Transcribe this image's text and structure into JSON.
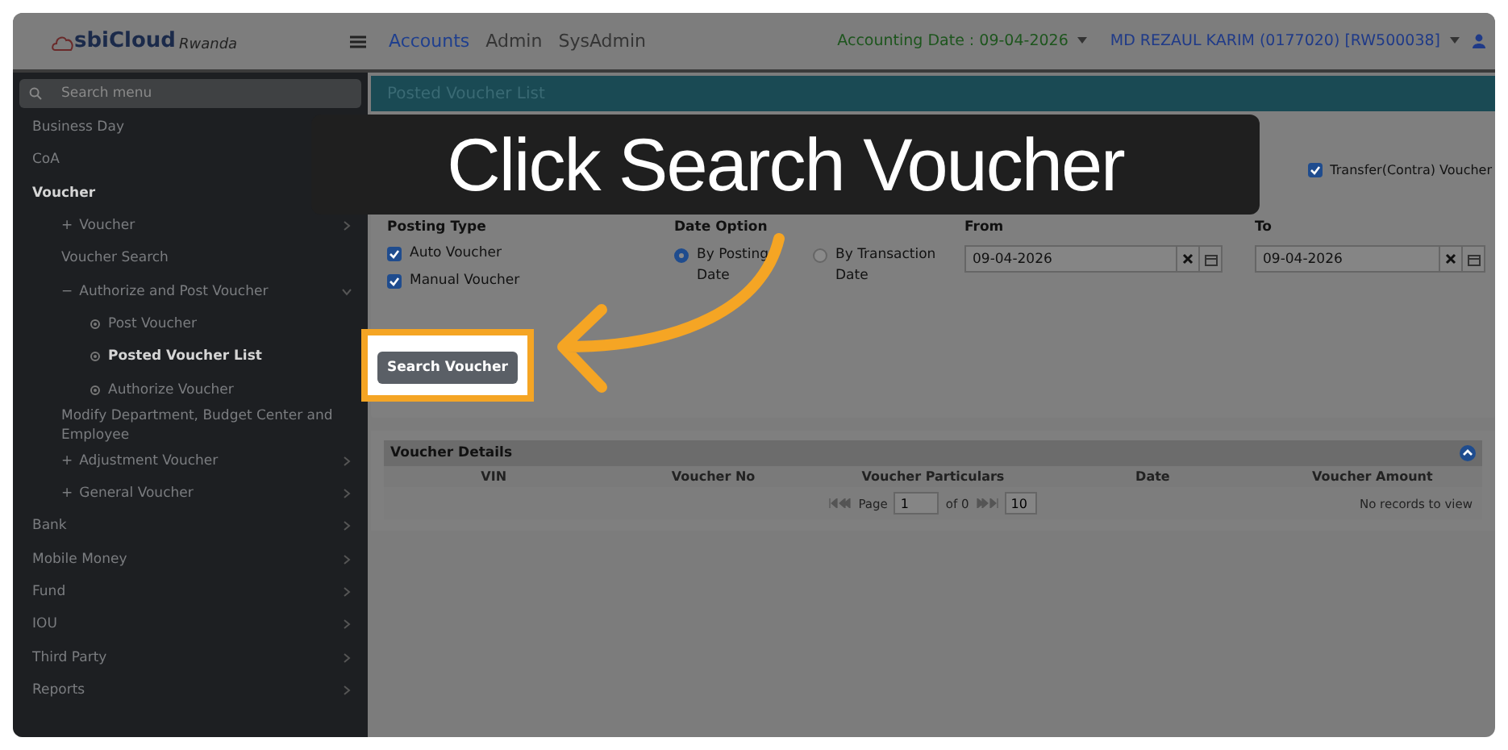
{
  "brand": {
    "name": "sbiCloud",
    "region": "Rwanda"
  },
  "nav": [
    {
      "label": "Accounts",
      "selected": true
    },
    {
      "label": "Admin",
      "selected": false
    },
    {
      "label": "SysAdmin",
      "selected": false
    }
  ],
  "accounting_date": "Accounting Date : 09-04-2026",
  "user": "MD REZAUL KARIM (0177020) [RW500038]",
  "sidebar": {
    "search_placeholder": "Search menu",
    "items": [
      {
        "label": "Business Day"
      },
      {
        "label": "CoA"
      },
      {
        "label": "Voucher",
        "submenu": true,
        "expanded": true,
        "children": [
          {
            "marker": "+",
            "label": "Voucher",
            "submenu": true,
            "expanded": false
          },
          {
            "label": "Voucher Search",
            "submenu": false
          },
          {
            "marker": "−",
            "label": "Authorize and Post Voucher",
            "submenu": true,
            "expanded": true,
            "children": [
              {
                "label": "Post Voucher",
                "bullet": true,
                "selected": false
              },
              {
                "label": "Posted Voucher List",
                "bullet": true,
                "selected": true
              },
              {
                "label": "Authorize Voucher",
                "bullet": true,
                "selected": false
              }
            ]
          },
          {
            "label": "Modify Department, Budget Center and Employee",
            "submenu": false
          },
          {
            "marker": "+",
            "label": "Adjustment Voucher",
            "submenu": true,
            "expanded": false
          },
          {
            "marker": "+",
            "label": "General Voucher",
            "submenu": true,
            "expanded": false
          }
        ]
      },
      {
        "label": "Bank",
        "submenu": true,
        "expanded": false
      },
      {
        "label": "Mobile Money",
        "submenu": true,
        "expanded": false
      },
      {
        "label": "Fund",
        "submenu": true,
        "expanded": false
      },
      {
        "label": "IOU",
        "submenu": true,
        "expanded": false
      },
      {
        "label": "Third Party",
        "submenu": true,
        "expanded": false
      },
      {
        "label": "Reports",
        "submenu": true,
        "expanded": false
      }
    ]
  },
  "page_title": "Posted Voucher List",
  "voucher_types": [
    {
      "label": "Transfer(Contra) Voucher",
      "checked": true
    }
  ],
  "posting_type": {
    "label": "Posting Type",
    "options": [
      {
        "label": "Auto Voucher",
        "checked": true
      },
      {
        "label": "Manual Voucher",
        "checked": true
      }
    ]
  },
  "date_option": {
    "label": "Date Option",
    "options": [
      {
        "label": "By Posting Date",
        "selected": true
      },
      {
        "label": "By Transaction Date",
        "selected": false
      }
    ]
  },
  "date_fields": [
    {
      "label": "From",
      "value": "09-04-2026"
    },
    {
      "label": "To",
      "value": "09-04-2026"
    }
  ],
  "search_button": "Search Voucher",
  "voucher_details": {
    "title": "Voucher Details",
    "expanded": true,
    "columns": [
      "VIN",
      "Voucher No",
      "Voucher Particulars",
      "Date",
      "Voucher Amount"
    ],
    "pager": {
      "page_label": "Page",
      "page": "1",
      "of": "of 0",
      "page_size": "10"
    },
    "empty_text": "No records to view"
  },
  "callout": {
    "text": "Click Search Voucher"
  }
}
